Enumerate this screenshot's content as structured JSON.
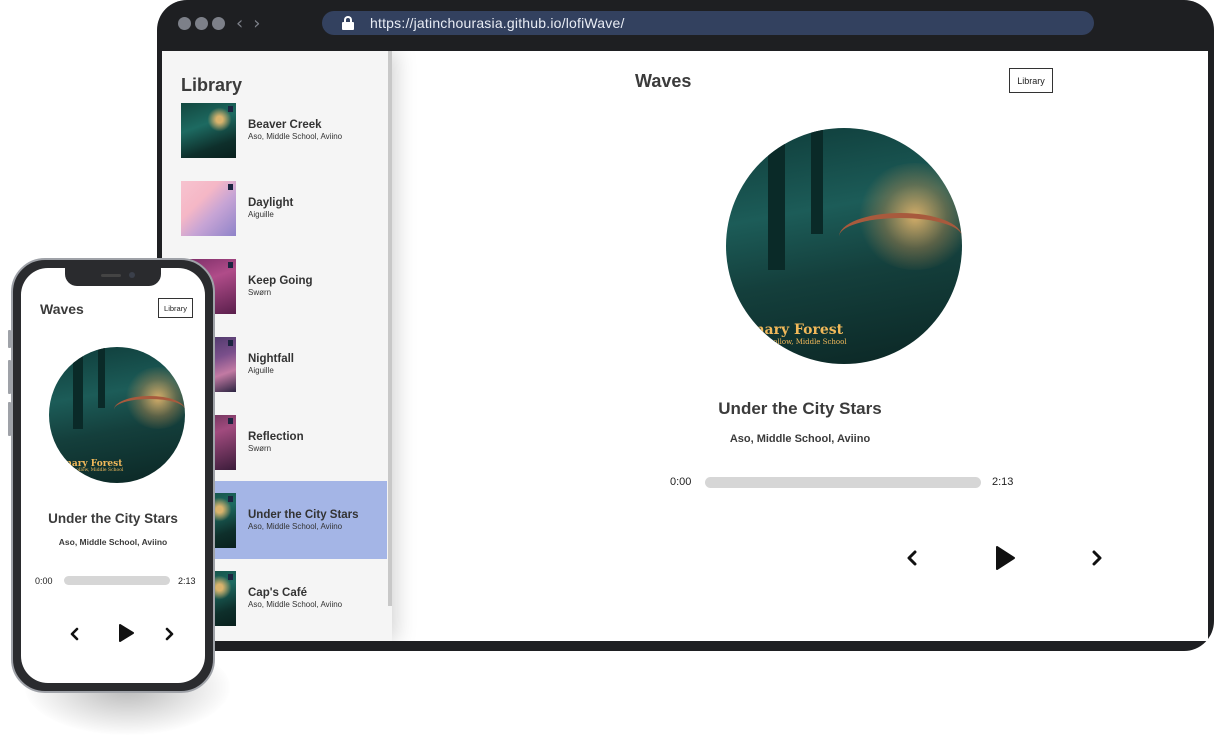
{
  "browser": {
    "url": "https://jatinchourasia.github.io/lofiWave/",
    "back_icon": "‹",
    "forward_icon": "›"
  },
  "library": {
    "title": "Library",
    "songs": [
      {
        "name": "Beaver Creek",
        "artist": "Aso, Middle School, Aviino",
        "cover": "forest"
      },
      {
        "name": "Daylight",
        "artist": "Aiguille",
        "cover": "daylight"
      },
      {
        "name": "Keep Going",
        "artist": "Swørn",
        "cover": "keep"
      },
      {
        "name": "Nightfall",
        "artist": "Aiguille",
        "cover": "night"
      },
      {
        "name": "Reflection",
        "artist": "Swørn",
        "cover": "reflect"
      },
      {
        "name": "Under the City Stars",
        "artist": "Aso, Middle School, Aviino",
        "cover": "forest",
        "active": true
      },
      {
        "name": "Cap's Café",
        "artist": "Aso, Middle School, Aviino",
        "cover": "forest"
      }
    ]
  },
  "player": {
    "logo": "Waves",
    "library_button": "Library",
    "cover_text_line1": "nary Forest",
    "cover_text_line2": "ollow, Middle School",
    "track_title": "Under the City Stars",
    "track_artist": "Aso, Middle School, Aviino",
    "current_time": "0:00",
    "duration": "2:13",
    "progress": 0
  },
  "phone": {
    "logo": "Waves",
    "library_button": "Library",
    "cover_text_line1": "nary Forest",
    "cover_text_line2": "ollow, Middle School",
    "track_title": "Under the City Stars",
    "track_artist": "Aso, Middle School, Aviino",
    "current_time": "0:00",
    "duration": "2:13",
    "progress": 0
  },
  "colors": {
    "active_song": "#a4b5e6",
    "address_bar": "#33415f",
    "frame": "#1e1f22",
    "text": "#3b3b3b"
  }
}
